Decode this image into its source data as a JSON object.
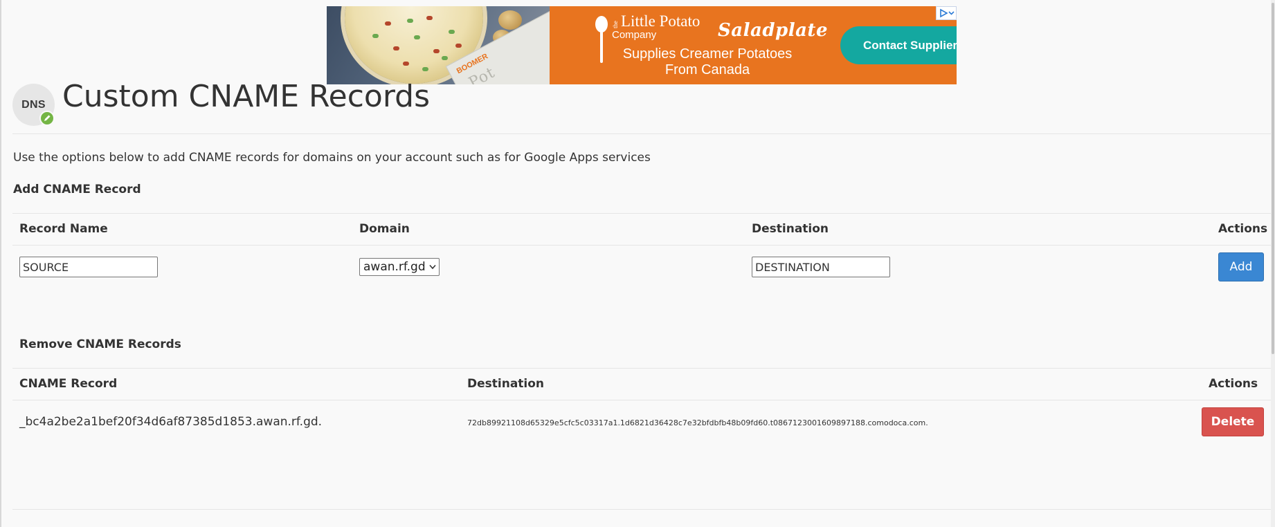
{
  "ad": {
    "brand_the": "the",
    "brand_name": "Little Potato",
    "brand_company": "Company",
    "partner": "Saladplate",
    "headline_line1": "Supplies Creamer Potatoes",
    "headline_line2": "From Canada",
    "cta": "Contact Supplier",
    "paper_small": "BOOMER",
    "paper_text": "Pot",
    "accent_color": "#e8741f",
    "cta_color": "#14a8a0",
    "choices_icon": "adchoices-icon"
  },
  "header": {
    "icon_text": "DNS",
    "badge_icon": "pencil-icon",
    "title": "Custom CNAME Records"
  },
  "description": "Use the options below to add CNAME records for domains on your account such as for Google Apps services",
  "add_section": {
    "title": "Add CNAME Record",
    "columns": {
      "record_name": "Record Name",
      "domain": "Domain",
      "destination": "Destination",
      "actions": "Actions"
    },
    "record_name_value": "SOURCE",
    "domain_selected": "awan.rf.gd",
    "destination_value": "DESTINATION",
    "add_label": "Add",
    "add_color": "#3a87d3"
  },
  "remove_section": {
    "title": "Remove CNAME Records",
    "columns": {
      "cname_record": "CNAME Record",
      "destination": "Destination",
      "actions": "Actions"
    },
    "rows": [
      {
        "cname": "_bc4a2be2a1bef20f34d6af87385d1853.awan.rf.gd.",
        "destination": "72db89921108d65329e5cfc5c03317a1.1d6821d36428c7e32bfdbfb48b09fd60.t0867123001609897188.comodoca.com.",
        "delete_label": "Delete"
      }
    ],
    "delete_color": "#d9534f"
  }
}
